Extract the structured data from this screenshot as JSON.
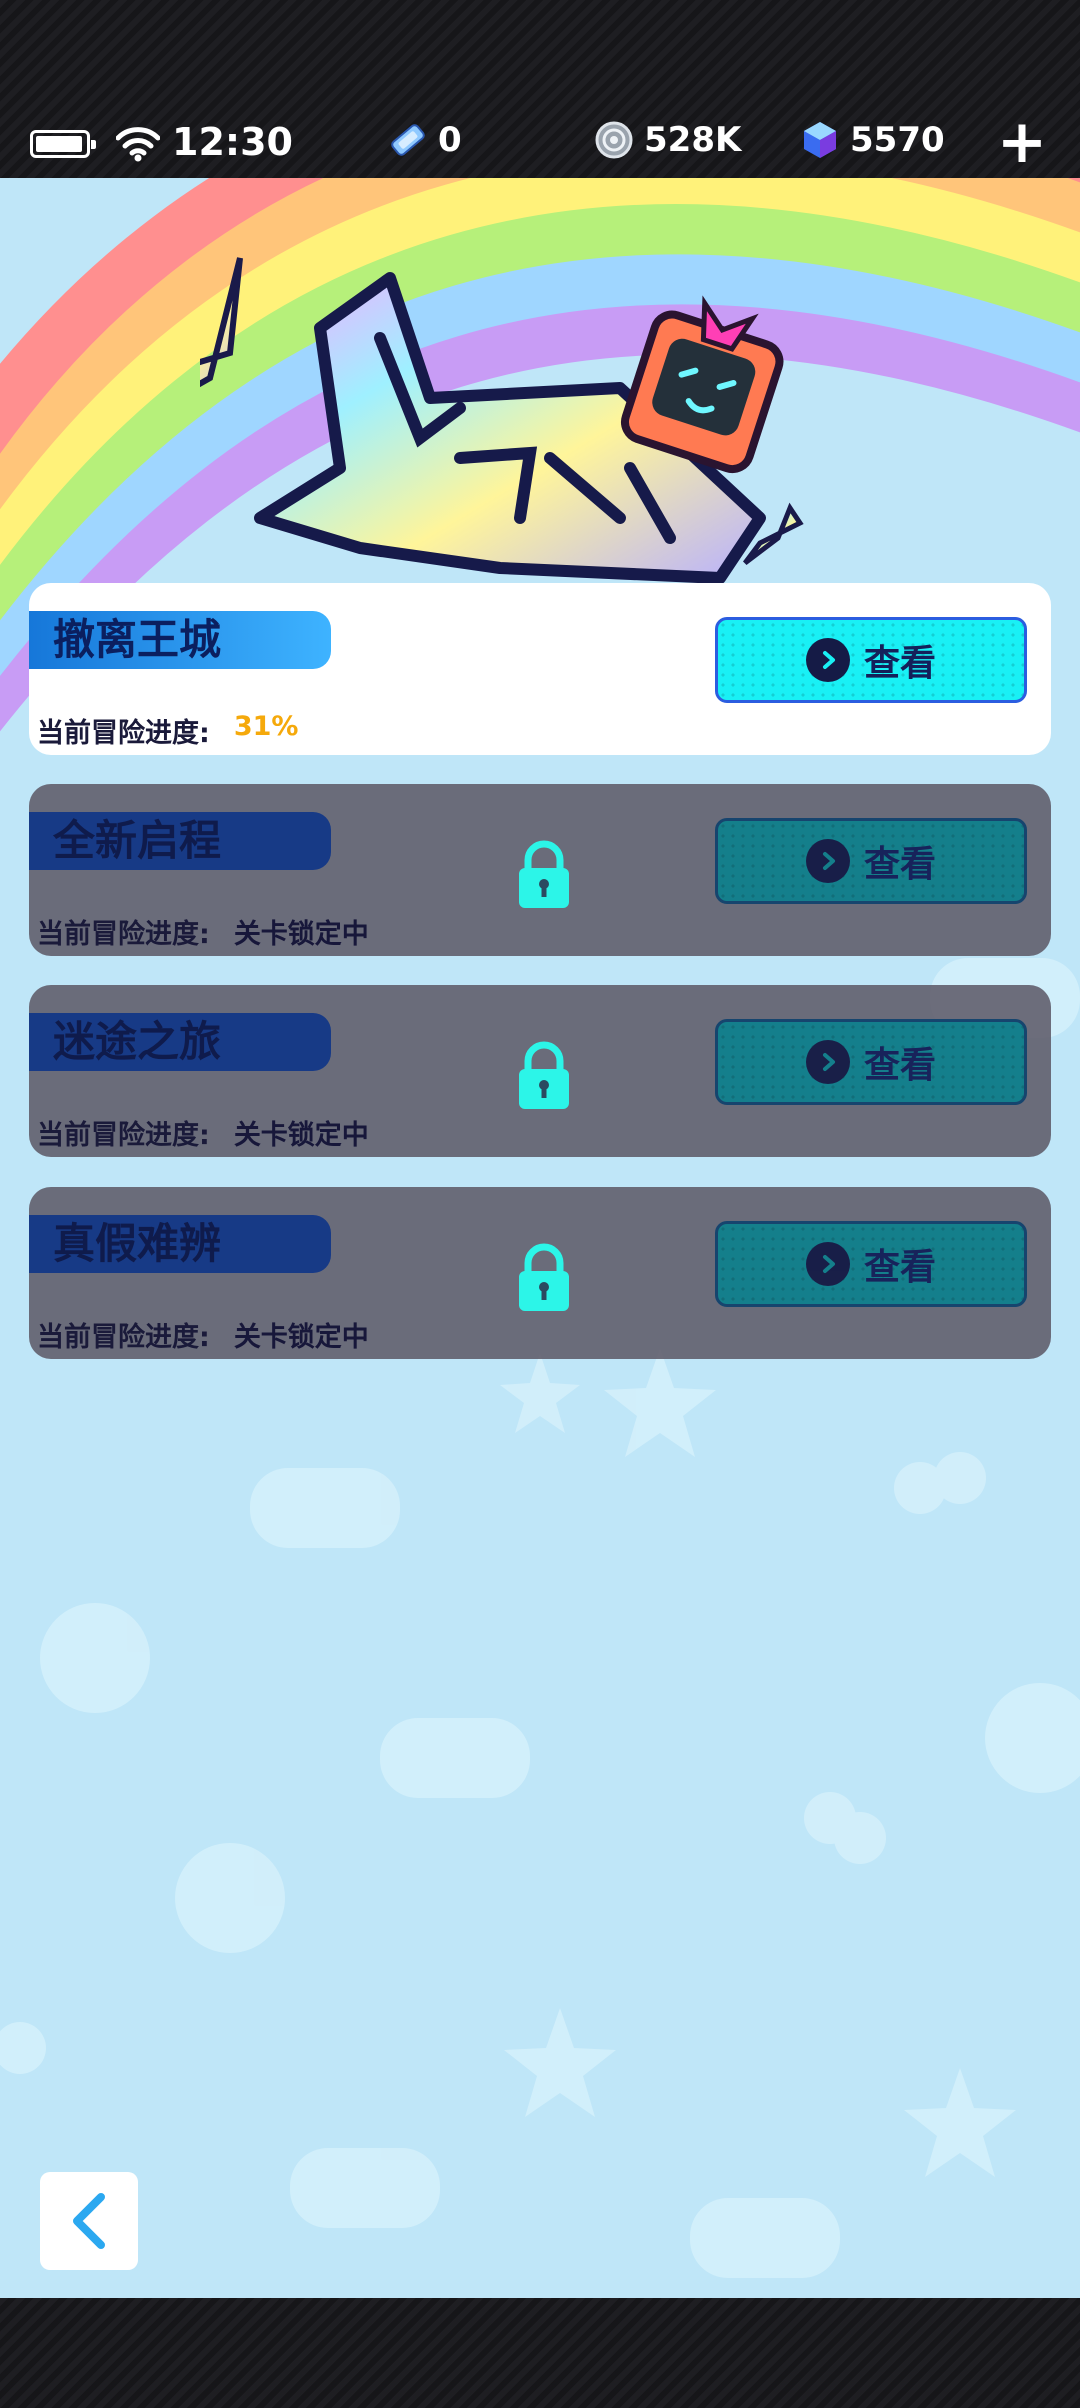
{
  "status": {
    "time": "12:30"
  },
  "resources": {
    "tickets": "0",
    "coins": "528K",
    "gems": "5570"
  },
  "colors": {
    "accent_cyan": "#19f0f5",
    "progress_orange": "#f5a90b",
    "title_blue": "#1677d9",
    "sky_background": "#bfe6f8"
  },
  "chapters": [
    {
      "title": "撤离王城",
      "progress_label": "当前冒险进度:",
      "progress_value": "31%",
      "button_label": "查看",
      "locked": false
    },
    {
      "title": "全新启程",
      "progress_label": "当前冒险进度:",
      "progress_value": "关卡锁定中",
      "button_label": "查看",
      "locked": true
    },
    {
      "title": "迷途之旅",
      "progress_label": "当前冒险进度:",
      "progress_value": "关卡锁定中",
      "button_label": "查看",
      "locked": true
    },
    {
      "title": "真假难辨",
      "progress_label": "当前冒险进度:",
      "progress_value": "关卡锁定中",
      "button_label": "查看",
      "locked": true
    }
  ],
  "icons": {
    "battery": "battery-icon",
    "wifi": "wifi-icon",
    "ticket": "ticket-icon",
    "coin": "coin-icon",
    "gem": "gem-icon",
    "add": "plus-icon",
    "lock": "lock-icon",
    "arrow": "chevron-right-icon",
    "back": "chevron-left-icon"
  }
}
